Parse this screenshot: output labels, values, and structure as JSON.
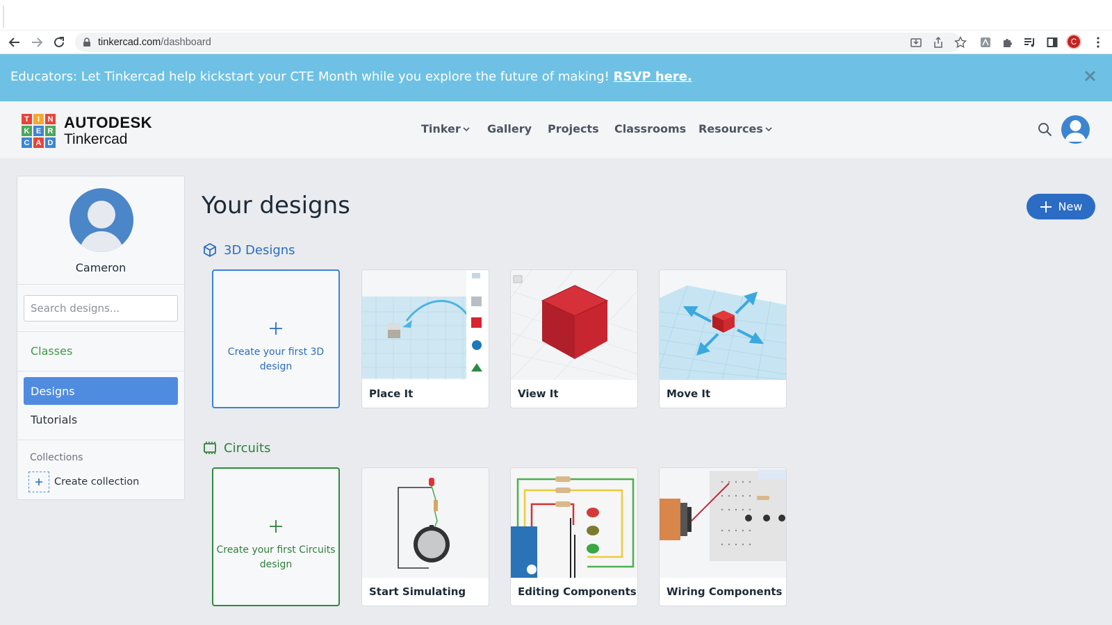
{
  "browser": {
    "url_host": "tinkercad.com",
    "url_path": "/dashboard",
    "profile_initial": "C"
  },
  "banner": {
    "text": "Educators: Let Tinkercad help kickstart your CTE Month while you explore the future of making!",
    "link": "RSVP here."
  },
  "brand": {
    "logo_letters": [
      "T",
      "I",
      "N",
      "K",
      "E",
      "R",
      "C",
      "A",
      "D"
    ],
    "line1": "AUTODESK",
    "line2": "Tinkercad"
  },
  "nav": {
    "tinker": "Tinker",
    "gallery": "Gallery",
    "projects": "Projects",
    "classrooms": "Classrooms",
    "resources": "Resources"
  },
  "sidebar": {
    "user_name": "Cameron",
    "search_placeholder": "Search designs...",
    "classes": "Classes",
    "designs": "Designs",
    "tutorials": "Tutorials",
    "collections": "Collections",
    "create_collection": "Create collection"
  },
  "main": {
    "title": "Your designs",
    "new_button": "New",
    "section_3d": "3D Designs",
    "section_circuits": "Circuits",
    "create_3d": "Create your first 3D design",
    "create_circuits": "Create your first Circuits design",
    "cards_3d": [
      "Place It",
      "View It",
      "Move It"
    ],
    "cards_circuits": [
      "Start Simulating",
      "Editing Components",
      "Wiring Components"
    ]
  },
  "colors": {
    "banner": "#6ec1e4",
    "accent_blue": "#2b6cc4",
    "selected_item": "#4f8ce0",
    "circuits_green": "#2d7f3a"
  }
}
